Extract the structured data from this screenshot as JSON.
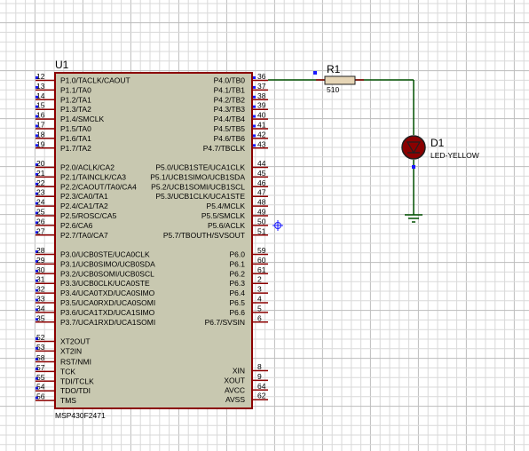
{
  "colors": {
    "background": "#ffffff",
    "grid_minor": "#d9d9d9",
    "grid_major": "#bdbdbd",
    "chip_body": "#c8c8b0",
    "chip_border": "#8b0000",
    "pin_line": "#8b0000",
    "wire": "#005000",
    "pin_dot": "#1a1aff",
    "resistor_body": "#e6d5b5",
    "led_body": "#8b0000",
    "led_outline": "#202020",
    "ground": "#005000",
    "text": "#000000"
  },
  "chip": {
    "refdes": "U1",
    "part": "MSP430F2471",
    "left_pins": [
      {
        "num": "12",
        "name": "P1.0/TACLK/CAOUT"
      },
      {
        "num": "13",
        "name": "P1.1/TA0"
      },
      {
        "num": "14",
        "name": "P1.2/TA1"
      },
      {
        "num": "15",
        "name": "P1.3/TA2"
      },
      {
        "num": "16",
        "name": "P1.4/SMCLK"
      },
      {
        "num": "17",
        "name": "P1.5/TA0"
      },
      {
        "num": "18",
        "name": "P1.6/TA1"
      },
      {
        "num": "19",
        "name": "P1.7/TA2"
      },
      {
        "num": "20",
        "name": "P2.0/ACLK/CA2"
      },
      {
        "num": "21",
        "name": "P2.1/TAINCLK/CA3"
      },
      {
        "num": "22",
        "name": "P2.2/CAOUT/TA0/CA4"
      },
      {
        "num": "23",
        "name": "P2.3/CA0/TA1"
      },
      {
        "num": "24",
        "name": "P2.4/CA1/TA2"
      },
      {
        "num": "25",
        "name": "P2.5/ROSC/CA5"
      },
      {
        "num": "26",
        "name": "P2.6/CA6"
      },
      {
        "num": "27",
        "name": "P2.7/TA0/CA7"
      },
      {
        "num": "28",
        "name": "P3.0/UCB0STE/UCA0CLK"
      },
      {
        "num": "29",
        "name": "P3.1/UCB0SIMO/UCB0SDA"
      },
      {
        "num": "30",
        "name": "P3.2/UCB0SOMI/UCB0SCL"
      },
      {
        "num": "31",
        "name": "P3.3/UCB0CLK/UCA0STE"
      },
      {
        "num": "32",
        "name": "P3.4/UCA0TXD/UCA0SIMO"
      },
      {
        "num": "33",
        "name": "P3.5/UCA0RXD/UCA0SOMI"
      },
      {
        "num": "34",
        "name": "P3.6/UCA1TXD/UCA1SIMO"
      },
      {
        "num": "35",
        "name": "P3.7/UCA1RXD/UCA1SOMI"
      },
      {
        "num": "52",
        "name": "XT2OUT"
      },
      {
        "num": "53",
        "name": "XT2IN"
      },
      {
        "num": "58",
        "name": "RST/NMI"
      },
      {
        "num": "57",
        "name": "TCK"
      },
      {
        "num": "55",
        "name": "TDI/TCLK"
      },
      {
        "num": "54",
        "name": "TDO/TDI"
      },
      {
        "num": "56",
        "name": "TMS"
      }
    ],
    "right_pins": [
      {
        "num": "36",
        "name": "P4.0/TB0"
      },
      {
        "num": "37",
        "name": "P4.1/TB1"
      },
      {
        "num": "38",
        "name": "P4.2/TB2"
      },
      {
        "num": "39",
        "name": "P4.3/TB3"
      },
      {
        "num": "40",
        "name": "P4.4/TB4"
      },
      {
        "num": "41",
        "name": "P4.5/TB5"
      },
      {
        "num": "42",
        "name": "P4.6/TB6"
      },
      {
        "num": "43",
        "name": "P4.7/TBCLK"
      },
      {
        "num": "44",
        "name": "P5.0/UCB1STE/UCA1CLK"
      },
      {
        "num": "45",
        "name": "P5.1/UCB1SIMO/UCB1SDA"
      },
      {
        "num": "46",
        "name": "P5.2/UCB1SOMI/UCB1SCL"
      },
      {
        "num": "47",
        "name": "P5.3/UCB1CLK/UCA1STE"
      },
      {
        "num": "48",
        "name": "P5.4/MCLK"
      },
      {
        "num": "49",
        "name": "P5.5/SMCLK"
      },
      {
        "num": "50",
        "name": "P5.6/ACLK"
      },
      {
        "num": "51",
        "name": "P5.7/TBOUTH/SVSOUT"
      },
      {
        "num": "59",
        "name": "P6.0"
      },
      {
        "num": "60",
        "name": "P6.1"
      },
      {
        "num": "61",
        "name": "P6.2"
      },
      {
        "num": "2",
        "name": "P6.3"
      },
      {
        "num": "3",
        "name": "P6.4"
      },
      {
        "num": "4",
        "name": "P6.5"
      },
      {
        "num": "5",
        "name": "P6.6"
      },
      {
        "num": "6",
        "name": "P6.7/SVSIN"
      },
      {
        "num": "8",
        "name": "XIN"
      },
      {
        "num": "9",
        "name": "XOUT"
      },
      {
        "num": "64",
        "name": "AVCC"
      },
      {
        "num": "62",
        "name": "AVSS"
      }
    ]
  },
  "resistor": {
    "refdes": "R1",
    "value": "510"
  },
  "led": {
    "refdes": "D1",
    "value": "LED-YELLOW"
  }
}
